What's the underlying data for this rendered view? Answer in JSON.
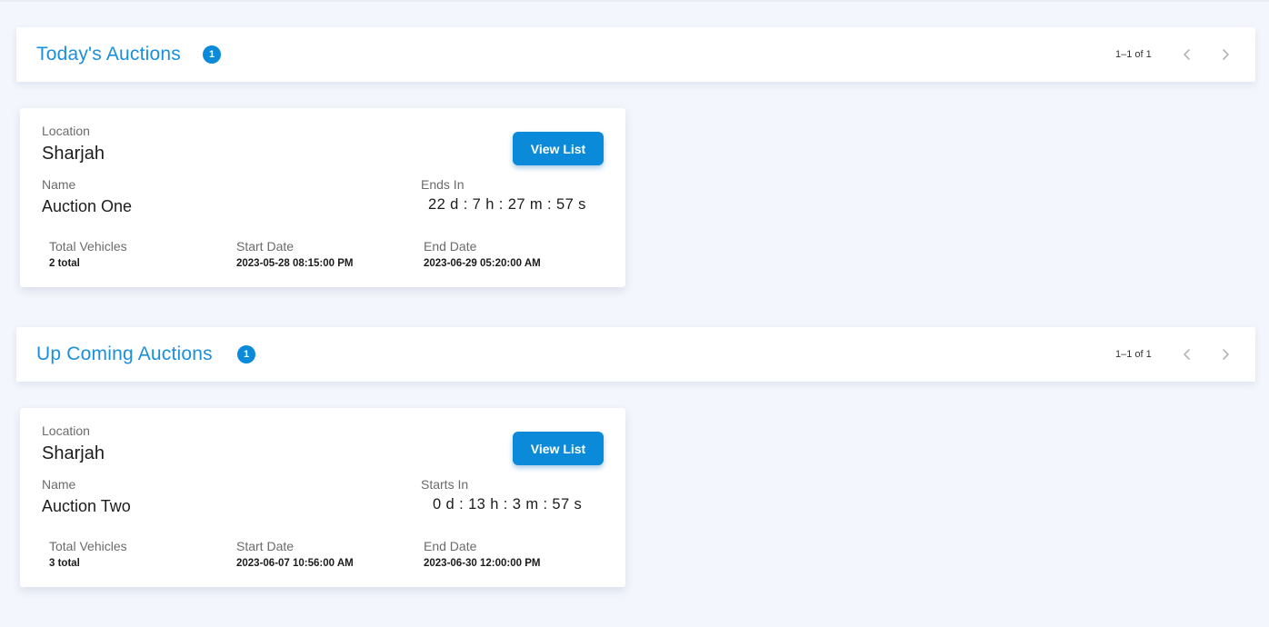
{
  "todays": {
    "title": "Today's Auctions",
    "count": "1",
    "pager": "1–1 of 1",
    "card": {
      "location_label": "Location",
      "location": "Sharjah",
      "view_button": "View List",
      "name_label": "Name",
      "name": "Auction One",
      "timer_label": "Ends In",
      "timer": "22 d : 7 h : 27 m : 57 s",
      "vehicles_label": "Total Vehicles",
      "vehicles": "2 total",
      "start_label": "Start Date",
      "start": "2023-05-28 08:15:00 PM",
      "end_label": "End Date",
      "end": "2023-06-29 05:20:00 AM"
    }
  },
  "upcoming": {
    "title": "Up Coming Auctions",
    "count": "1",
    "pager": "1–1 of 1",
    "card": {
      "location_label": "Location",
      "location": "Sharjah",
      "view_button": "View List",
      "name_label": "Name",
      "name": "Auction Two",
      "timer_label": "Starts In",
      "timer": "0 d : 13 h : 3 m : 57 s",
      "vehicles_label": "Total Vehicles",
      "vehicles": "3 total",
      "start_label": "Start Date",
      "start": "2023-06-07 10:56:00 AM",
      "end_label": "End Date",
      "end": "2023-06-30 12:00:00 PM"
    }
  },
  "icons": {
    "prev": "chevron-left-icon",
    "next": "chevron-right-icon"
  },
  "colors": {
    "accent": "#0a8ad8",
    "title": "#1a8fdc",
    "background": "#f3f6fc"
  }
}
